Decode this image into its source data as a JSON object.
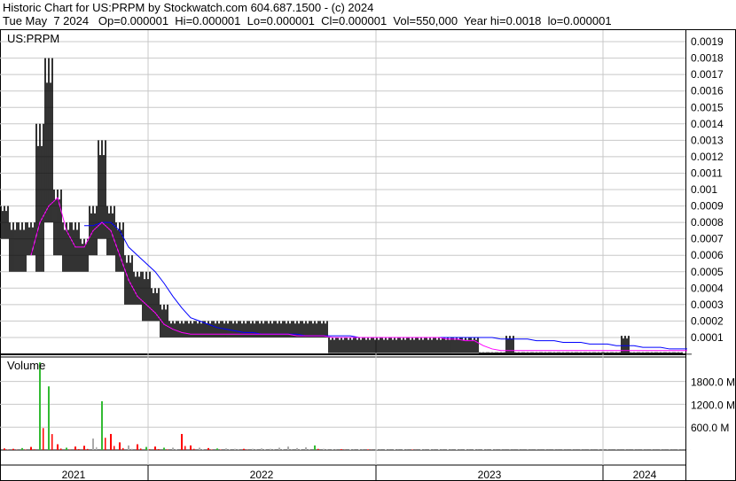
{
  "header": {
    "title": "Historic Chart for US:PRPM by Stockwatch.com 604.687.1500 - (c) 2024",
    "quote": "Tue May  7 2024   Op=0.000001  Hi=0.000001  Lo=0.000001  Cl=0.000001  Vol=550,000  Year hi=0.0018  lo=0.000001"
  },
  "chart_data": [
    {
      "type": "bar",
      "title": "US:PRPM",
      "subtype": "hi-lo price bars with moving averages",
      "x_unit": "biweekly periods from Apr 2021",
      "y_ticks": [
        "0.0001",
        "0.0002",
        "0.0003",
        "0.0004",
        "0.0005",
        "0.0006",
        "0.0007",
        "0.0008",
        "0.0009",
        "0.001",
        "0.0011",
        "0.0012",
        "0.0013",
        "0.0014",
        "0.0015",
        "0.0016",
        "0.0017",
        "0.0018",
        "0.0019"
      ],
      "ylim": [
        0,
        0.00195
      ],
      "high": [
        0.0009,
        0.0008,
        0.0008,
        0.0008,
        0.0014,
        0.0018,
        0.001,
        0.0008,
        0.0008,
        0.0007,
        0.0009,
        0.0013,
        0.0009,
        0.0008,
        0.0006,
        0.0005,
        0.0005,
        0.0004,
        0.0003,
        0.0002,
        0.0002,
        0.0002,
        0.0002,
        0.0002,
        0.0002,
        0.0002,
        0.0002,
        0.0002,
        0.0002,
        0.0002,
        0.0002,
        0.0002,
        0.0002,
        0.0002,
        0.0002,
        0.0002,
        0.0002,
        0.0001,
        0.0001,
        0.0001,
        0.0001,
        0.0001,
        0.0001,
        0.0001,
        0.0001,
        0.0001,
        0.0001,
        0.0001,
        0.0001,
        0.0001,
        0.0001,
        0.0001,
        0.0001,
        0.0001,
        1e-05,
        1e-05,
        1e-05,
        0.00011,
        1e-05,
        1e-05,
        1e-05,
        1e-05,
        1e-05,
        1e-05,
        1e-05,
        1e-05,
        1e-05,
        1e-05,
        1e-05,
        1e-05,
        0.00011,
        1e-05,
        1e-05,
        1e-05,
        1e-05,
        1e-05,
        1e-05,
        1e-06
      ],
      "low": [
        0.0007,
        0.0005,
        0.0005,
        0.0006,
        0.0005,
        0.0008,
        0.0006,
        0.0005,
        0.0005,
        0.0005,
        0.0006,
        0.0007,
        0.0006,
        0.0005,
        0.0003,
        0.0003,
        0.0002,
        0.0002,
        0.0001,
        0.0001,
        0.0001,
        0.0001,
        0.0001,
        0.0001,
        0.0001,
        0.0001,
        0.0001,
        0.0001,
        0.0001,
        0.0001,
        0.0001,
        0.0001,
        0.0001,
        0.0001,
        0.0001,
        0.0001,
        0.0001,
        5e-06,
        5e-06,
        5e-06,
        5e-06,
        5e-06,
        5e-06,
        5e-06,
        5e-06,
        5e-06,
        5e-06,
        5e-06,
        5e-06,
        5e-06,
        5e-06,
        5e-06,
        5e-06,
        5e-06,
        1e-06,
        1e-06,
        1e-06,
        1e-06,
        1e-06,
        1e-06,
        1e-06,
        1e-06,
        1e-06,
        1e-06,
        1e-06,
        1e-06,
        1e-06,
        1e-06,
        1e-06,
        1e-06,
        1e-06,
        1e-06,
        1e-06,
        1e-06,
        1e-06,
        1e-06,
        1e-06,
        1e-06
      ],
      "ma_short": [
        null,
        null,
        null,
        0.0006,
        0.0008,
        0.0009,
        0.00095,
        0.00075,
        0.00065,
        0.00065,
        0.00075,
        0.0008,
        0.00075,
        0.0006,
        0.00045,
        0.00035,
        0.0003,
        0.00025,
        0.00018,
        0.00015,
        0.00013,
        0.00012,
        0.00012,
        0.00012,
        0.00012,
        0.00012,
        0.00012,
        0.00012,
        0.00012,
        0.00012,
        0.00012,
        0.00012,
        0.00012,
        0.00011,
        0.00011,
        0.00011,
        0.00011,
        0.0001,
        0.0001,
        0.0001,
        0.0001,
        0.0001,
        0.0001,
        0.0001,
        0.0001,
        0.0001,
        0.0001,
        0.0001,
        0.0001,
        0.0001,
        9e-05,
        9e-05,
        8e-05,
        8e-05,
        5e-05,
        3e-05,
        2e-05,
        2e-05,
        2e-05,
        2e-05,
        2e-05,
        2e-05,
        2e-05,
        2e-05,
        2e-05,
        2e-05,
        2e-05,
        2e-05,
        2e-05,
        2e-05,
        2e-05,
        2e-05,
        2e-05,
        2e-05,
        2e-05,
        2e-05,
        2e-05,
        2e-05
      ],
      "ma_long": [
        null,
        null,
        null,
        null,
        null,
        null,
        null,
        null,
        null,
        0.00078,
        0.00078,
        0.0008,
        0.0008,
        0.00075,
        0.00065,
        0.0006,
        0.00055,
        0.0005,
        0.00043,
        0.00035,
        0.00028,
        0.00022,
        0.0002,
        0.00018,
        0.00016,
        0.00015,
        0.00014,
        0.00013,
        0.00013,
        0.00012,
        0.00012,
        0.00012,
        0.00012,
        0.00012,
        0.00011,
        0.00011,
        0.00011,
        0.00011,
        0.00011,
        0.00011,
        0.0001,
        0.0001,
        0.0001,
        0.0001,
        0.0001,
        0.0001,
        0.0001,
        0.0001,
        0.0001,
        0.0001,
        0.0001,
        0.0001,
        0.0001,
        0.0001,
        0.0001,
        0.0001,
        9e-05,
        9e-05,
        9e-05,
        9e-05,
        8e-05,
        8e-05,
        8e-05,
        7e-05,
        7e-05,
        7e-05,
        6e-05,
        6e-05,
        6e-05,
        5e-05,
        5e-05,
        5e-05,
        4e-05,
        4e-05,
        4e-05,
        3e-05,
        3e-05,
        3e-05
      ]
    },
    {
      "type": "bar",
      "title": "Volume",
      "y_ticks": [
        "600.0 M",
        "1200.0 M",
        "1800.0 M"
      ],
      "ylim": [
        0,
        2400
      ],
      "volume_m": [
        40,
        30,
        50,
        80,
        2300,
        1670,
        150,
        60,
        90,
        110,
        300,
        1280,
        420,
        200,
        120,
        150,
        80,
        90,
        60,
        60,
        420,
        120,
        60,
        50,
        40,
        40,
        30,
        30,
        30,
        40,
        30,
        60,
        90,
        50,
        70,
        120,
        30,
        20,
        20,
        15,
        15,
        15,
        10,
        10,
        10,
        10,
        10,
        10,
        10,
        10,
        10,
        10,
        10,
        10,
        10,
        10,
        5,
        5,
        5,
        5,
        5,
        5,
        5,
        5,
        5,
        5,
        5,
        5,
        5,
        5,
        5,
        5,
        5,
        5,
        5,
        5,
        5,
        5
      ],
      "volume_color": [
        "r",
        "r",
        "g",
        "r",
        "g",
        "g",
        "r",
        "g",
        "r",
        "r",
        "gray",
        "g",
        "r",
        "r",
        "gray",
        "r",
        "g",
        "r",
        "g",
        "gray",
        "r",
        "r",
        "gray",
        "r",
        "g",
        "gray",
        "gray",
        "r",
        "gray",
        "gray",
        "gray",
        "gray",
        "gray",
        "gray",
        "gray",
        "g",
        "gray",
        "gray",
        "r",
        "gray",
        "gray",
        "r",
        "gray",
        "gray",
        "gray",
        "gray",
        "r",
        "gray",
        "gray",
        "gray",
        "gray",
        "gray",
        "gray",
        "gray",
        "gray",
        "gray",
        "gray",
        "gray",
        "gray",
        "gray",
        "gray",
        "gray",
        "gray",
        "gray",
        "gray",
        "gray",
        "gray",
        "gray",
        "gray",
        "gray",
        "gray",
        "gray",
        "gray",
        "gray",
        "gray",
        "gray",
        "gray",
        "gray"
      ]
    }
  ],
  "x_axis": {
    "labels": [
      "2021",
      "2022",
      "2023",
      "2024"
    ]
  },
  "colors": {
    "bars": "#000000",
    "ma_short": "#ff00ff",
    "ma_long": "#0000ff",
    "up": "#33bb33",
    "down": "#ff0000",
    "neutral": "#aaaaaa",
    "grid": "#c8c8c8"
  }
}
